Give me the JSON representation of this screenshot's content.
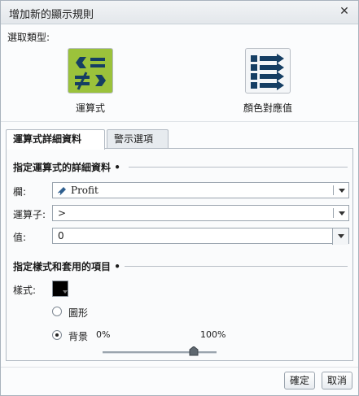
{
  "dialog": {
    "title": "增加新的顯示規則",
    "close_glyph": "✕"
  },
  "type_section": {
    "label": "選取類型:",
    "options": [
      {
        "label": "運算式",
        "icon": "not-equal-operator-icon",
        "selected": true,
        "tile_color": "#9bc23b"
      },
      {
        "label": "顏色對應值",
        "icon": "list-arrows-icon",
        "selected": false,
        "tile_color": "#f4f6f8"
      }
    ]
  },
  "tabs": [
    {
      "label": "運算式詳細資料",
      "active": true
    },
    {
      "label": "警示選項",
      "active": false
    }
  ],
  "expression": {
    "heading": "指定運算式的詳細資料",
    "column": {
      "label": "欄:",
      "value": "Profit"
    },
    "operator": {
      "label": "運算子:",
      "value": ">"
    },
    "value": {
      "label": "值:",
      "value": "0"
    }
  },
  "style": {
    "heading": "指定樣式和套用的項目",
    "style_label": "樣式:",
    "swatch_color": "#000000",
    "radios": [
      {
        "label": "圖形",
        "checked": false
      },
      {
        "label": "背景",
        "checked": true
      }
    ],
    "transparency_min": "0%",
    "transparency_max": "100%",
    "transparency_value_pct": 80
  },
  "buttons": {
    "ok": "確定",
    "cancel": "取消"
  }
}
